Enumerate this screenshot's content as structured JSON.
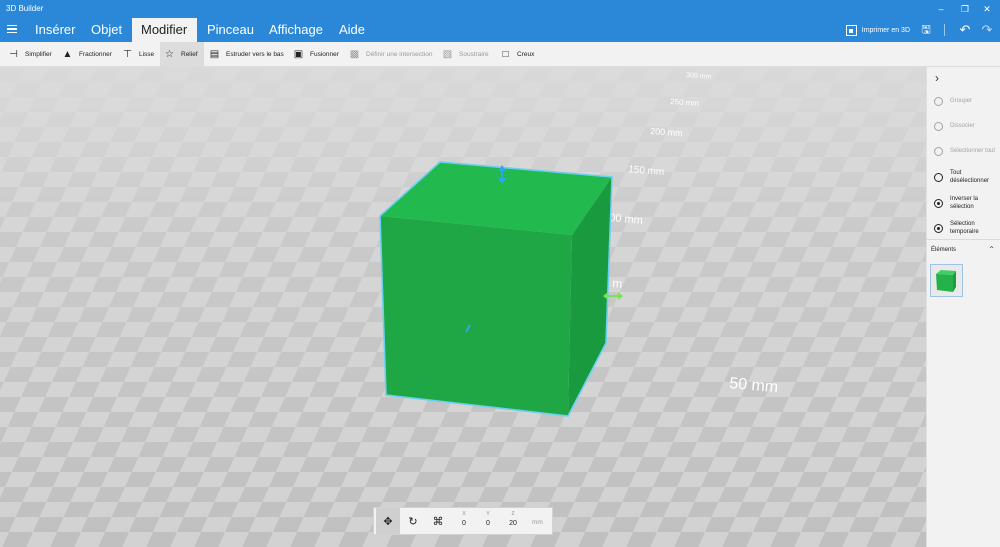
{
  "app": {
    "title": "3D Builder"
  },
  "menu": {
    "tabs": [
      {
        "label": "Insérer"
      },
      {
        "label": "Objet"
      },
      {
        "label": "Modifier"
      },
      {
        "label": "Pinceau"
      },
      {
        "label": "Affichage"
      },
      {
        "label": "Aide"
      }
    ],
    "active_tab": "Modifier",
    "print_label": "Imprimer en 3D"
  },
  "toolbar": {
    "tools": [
      {
        "label": "Simplifier",
        "icon": "simplify-icon",
        "enabled": true
      },
      {
        "label": "Fractionner",
        "icon": "split-icon",
        "enabled": true
      },
      {
        "label": "Lisse",
        "icon": "smooth-icon",
        "enabled": true
      },
      {
        "label": "Relief",
        "icon": "emboss-star-icon",
        "enabled": true,
        "active": true
      },
      {
        "label": "Estruder vers le bas",
        "icon": "extrude-down-icon",
        "enabled": true
      },
      {
        "label": "Fusionner",
        "icon": "merge-icon",
        "enabled": true
      },
      {
        "label": "Définir une intersection",
        "icon": "intersect-icon",
        "enabled": false
      },
      {
        "label": "Soustraire",
        "icon": "subtract-icon",
        "enabled": false
      },
      {
        "label": "Creux",
        "icon": "hollow-icon",
        "enabled": true
      }
    ]
  },
  "viewport": {
    "ruler_labels": [
      "300 mm",
      "250 mm",
      "200 mm",
      "150 mm",
      "00 mm",
      "m",
      "50 mm"
    ],
    "object_color": "#1fb24a",
    "selection_color": "#5ec8f0"
  },
  "right_panel": {
    "items": [
      {
        "label": "Grouper",
        "enabled": false
      },
      {
        "label": "Dissocier",
        "enabled": false
      },
      {
        "label": "Sélectionner tout",
        "enabled": false
      },
      {
        "label": "Tout désélectionner",
        "enabled": true
      },
      {
        "label": "Inverser la sélection",
        "enabled": true
      },
      {
        "label": "Sélection temporaire",
        "enabled": true
      }
    ],
    "elements_label": "Éléments"
  },
  "transform": {
    "x_label": "X",
    "x": "0",
    "y_label": "Y",
    "y": "0",
    "z_label": "Z",
    "z": "20",
    "unit": "mm"
  },
  "colors": {
    "accent": "#2b88d8",
    "panel": "#f2f2f2"
  }
}
